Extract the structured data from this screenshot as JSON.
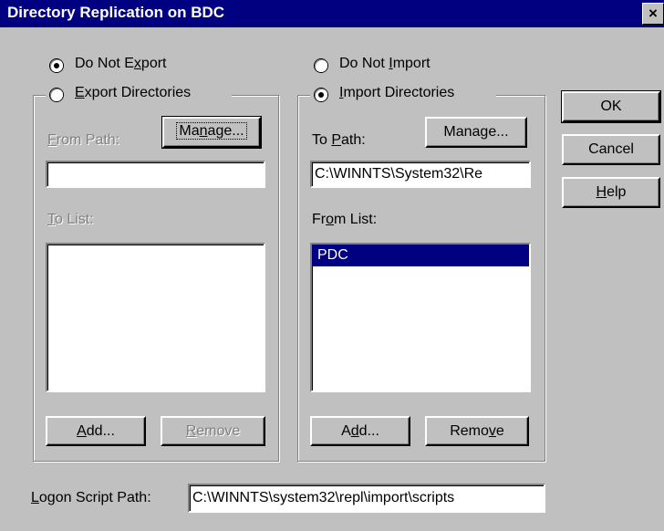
{
  "window": {
    "title": "Directory Replication on BDC",
    "close_glyph": "×"
  },
  "export": {
    "do_not_export": {
      "pre": "Do Not E",
      "key": "x",
      "post": "port",
      "checked": true
    },
    "export_directories": {
      "pre": "",
      "key": "E",
      "post": "xport Directories",
      "checked": false
    },
    "from_path": {
      "pre": "",
      "key": "F",
      "post": "rom Path:"
    },
    "manage_button": {
      "pre": "Ma",
      "key": "n",
      "post": "age..."
    },
    "from_path_value": "",
    "to_list": {
      "pre": "",
      "key": "T",
      "post": "o List:"
    },
    "to_list_items": [],
    "add_button": {
      "pre": "",
      "key": "A",
      "post": "dd..."
    },
    "remove_button": {
      "pre": "",
      "key": "R",
      "post": "emove"
    }
  },
  "import": {
    "do_not_import": {
      "pre": "Do Not ",
      "key": "I",
      "post": "mport",
      "checked": false
    },
    "import_directories": {
      "pre": "",
      "key": "I",
      "post": "mport Directories",
      "checked": true
    },
    "to_path": {
      "pre": "To ",
      "key": "P",
      "post": "ath:"
    },
    "manage_button": {
      "pre": "Manage",
      "key": "",
      "post": "..."
    },
    "to_path_value": "C:\\WINNTS\\System32\\Re",
    "from_list": {
      "pre": "Fr",
      "key": "o",
      "post": "m List:"
    },
    "from_list_items": [
      "PDC"
    ],
    "add_button": {
      "pre": "A",
      "key": "d",
      "post": "d..."
    },
    "remove_button": {
      "pre": "Remo",
      "key": "v",
      "post": "e"
    }
  },
  "buttons": {
    "ok": "OK",
    "cancel": "Cancel",
    "help": {
      "pre": "",
      "key": "H",
      "post": "elp"
    }
  },
  "logon_script": {
    "label": {
      "pre": "",
      "key": "L",
      "post": "ogon Script Path:"
    },
    "value": "C:\\WINNTS\\system32\\repl\\import\\scripts"
  }
}
